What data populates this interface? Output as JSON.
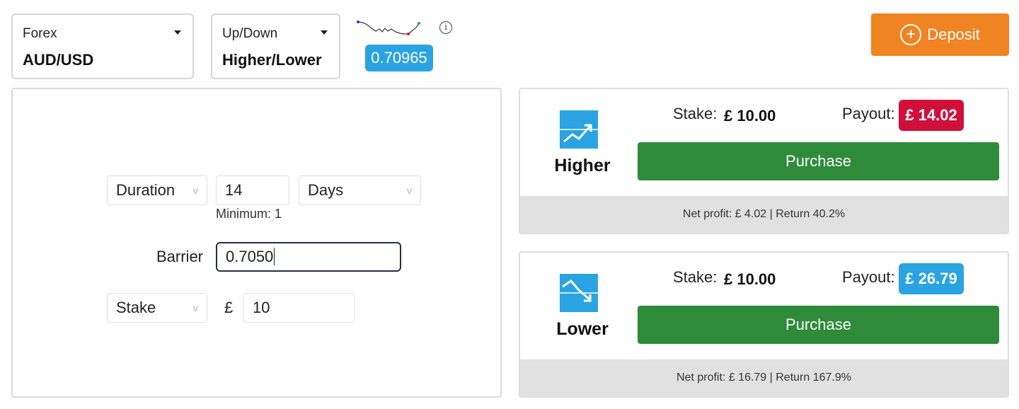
{
  "market": {
    "label": "Forex",
    "value": "AUD/USD"
  },
  "trade_type": {
    "label": "Up/Down",
    "value": "Higher/Lower"
  },
  "spot_price": "0.70965",
  "info": "i",
  "deposit": {
    "label": "Deposit",
    "icon": "plus-circle-icon",
    "color": "#f08322"
  },
  "form": {
    "duration_mode": "Duration",
    "duration_amount": "14",
    "duration_unit": "Days",
    "minimum_text": "Minimum: 1",
    "barrier_label": "Barrier",
    "barrier_value": "0.7050",
    "stake_mode": "Stake",
    "currency_symbol": "£",
    "stake_amount": "10",
    "dropdown_chevron": "v"
  },
  "contracts": {
    "higher": {
      "label": "Higher",
      "icon": "trend-up-icon",
      "stake_label": "Stake:",
      "stake_value": "£ 10.00",
      "payout_label": "Payout:",
      "payout_value": "£ 14.02",
      "payout_color": "#d0103a",
      "purchase_label": "Purchase",
      "footer": "Net profit: £ 4.02 | Return 40.2%"
    },
    "lower": {
      "label": "Lower",
      "icon": "trend-down-icon",
      "stake_label": "Stake:",
      "stake_value": "£ 10.00",
      "payout_label": "Payout:",
      "payout_value": "£ 26.79",
      "payout_color": "#2aa3e3",
      "purchase_label": "Purchase",
      "footer": "Net profit: £ 16.79 | Return 167.9%"
    }
  },
  "colors": {
    "purchase_green": "#2e8b3a",
    "spot_blue": "#2aa3e3",
    "icon_blue": "#2aa3e3"
  }
}
